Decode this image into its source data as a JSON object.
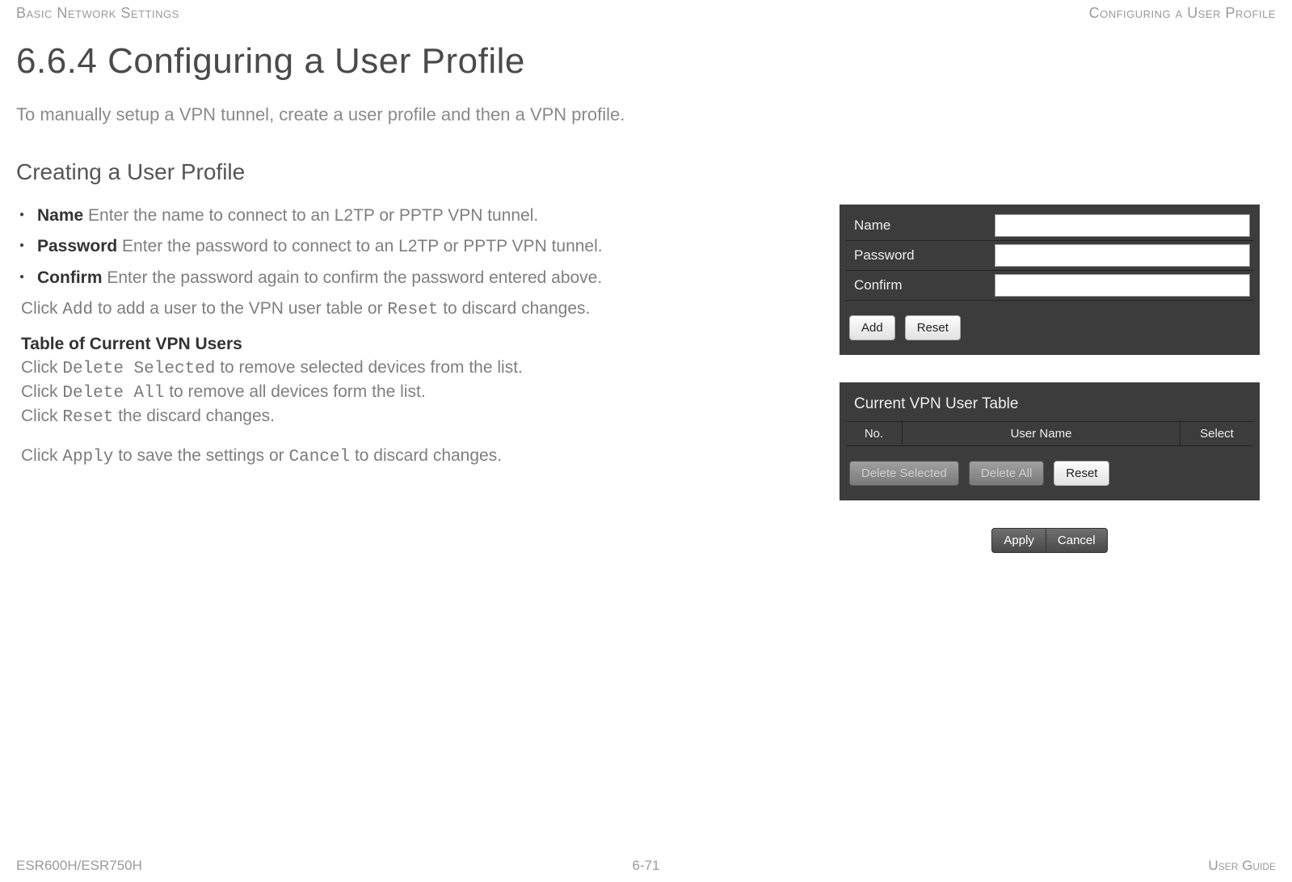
{
  "header": {
    "left": "Basic Network Settings",
    "right": "Configuring a User Profile"
  },
  "title": "6.6.4 Configuring a User Profile",
  "intro": "To manually setup a VPN tunnel, create a user profile and then a VPN profile.",
  "subtitle": "Creating a User Profile",
  "bullets": [
    {
      "label": "Name",
      "text": "  Enter the name to connect to an L2TP or PPTP VPN tunnel."
    },
    {
      "label": "Password",
      "text": "  Enter the password to connect to an L2TP or PPTP VPN tunnel."
    },
    {
      "label": "Confirm",
      "text": "  Enter the password again to confirm the pass­word entered above."
    }
  ],
  "para_add": {
    "pre": "Click ",
    "code1": "Add",
    "mid1": " to add a user to the VPN user table or ",
    "code2": "Reset",
    "mid2": " to discard changes."
  },
  "table_heading": "Table of Current VPN Users",
  "para_del": {
    "l1a": "Click ",
    "l1code": "Delete Selected",
    "l1b": " to remove selected devices from the list.",
    "l2a": "Click ",
    "l2code": "Delete All",
    "l2b": " to remove all devices form the list.",
    "l3a": "Click ",
    "l3code": "Reset",
    "l3b": " the discard changes."
  },
  "para_apply": {
    "pre": "Click ",
    "code1": "Apply",
    "mid1": " to save the settings or ",
    "code2": "Cancel",
    "mid2": " to discard changes."
  },
  "form": {
    "rows": [
      {
        "label": "Name",
        "value": ""
      },
      {
        "label": "Password",
        "value": ""
      },
      {
        "label": "Confirm",
        "value": ""
      }
    ],
    "buttons": {
      "add": "Add",
      "reset": "Reset"
    }
  },
  "user_table": {
    "title": "Current VPN User Table",
    "cols": {
      "no": "No.",
      "user": "User Name",
      "select": "Select"
    },
    "buttons": {
      "del_sel": "Delete Selected",
      "del_all": "Delete All",
      "reset": "Reset"
    }
  },
  "apply_panel": {
    "apply": "Apply",
    "cancel": "Cancel"
  },
  "footer": {
    "left": "ESR600H/ESR750H",
    "center": "6-71",
    "right": "User Guide"
  }
}
